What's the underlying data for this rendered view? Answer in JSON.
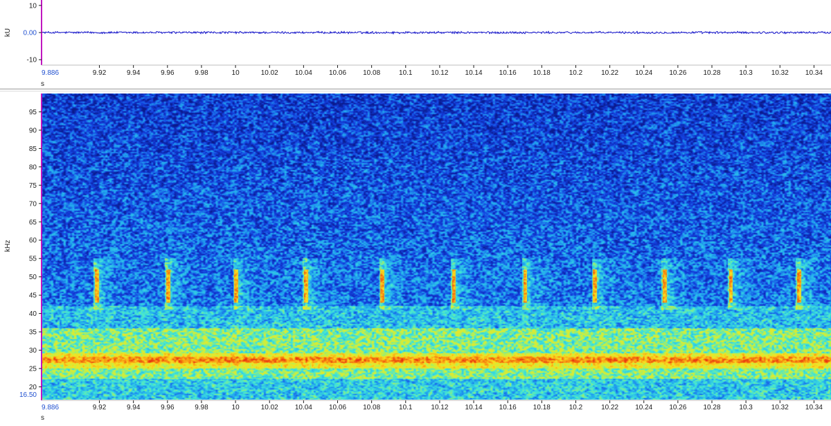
{
  "chart_data": [
    {
      "type": "line",
      "panel": "waveform",
      "ylabel": "kU",
      "xlabel": "s",
      "xlim": [
        9.886,
        10.35
      ],
      "ylim": [
        -12,
        12
      ],
      "y_ticks": [
        {
          "value": 10,
          "label": "10"
        },
        {
          "value": 0,
          "label": "0.00"
        },
        {
          "value": -10,
          "label": "-10"
        }
      ],
      "x_start_label": "9.886",
      "x_ticks": [
        {
          "value": 9.92,
          "label": "9.92"
        },
        {
          "value": 9.94,
          "label": "9.94"
        },
        {
          "value": 9.96,
          "label": "9.96"
        },
        {
          "value": 9.98,
          "label": "9.98"
        },
        {
          "value": 10.0,
          "label": "10"
        },
        {
          "value": 10.02,
          "label": "10.02"
        },
        {
          "value": 10.04,
          "label": "10.04"
        },
        {
          "value": 10.06,
          "label": "10.06"
        },
        {
          "value": 10.08,
          "label": "10.08"
        },
        {
          "value": 10.1,
          "label": "10.1"
        },
        {
          "value": 10.12,
          "label": "10.12"
        },
        {
          "value": 10.14,
          "label": "10.14"
        },
        {
          "value": 10.16,
          "label": "10.16"
        },
        {
          "value": 10.18,
          "label": "10.18"
        },
        {
          "value": 10.2,
          "label": "10.2"
        },
        {
          "value": 10.22,
          "label": "10.22"
        },
        {
          "value": 10.24,
          "label": "10.24"
        },
        {
          "value": 10.26,
          "label": "10.26"
        },
        {
          "value": 10.28,
          "label": "10.28"
        },
        {
          "value": 10.3,
          "label": "10.3"
        },
        {
          "value": 10.32,
          "label": "10.32"
        },
        {
          "value": 10.34,
          "label": "10.34"
        }
      ],
      "noise_amplitude": 0.35,
      "color": "#1010c8",
      "grid": false
    },
    {
      "type": "heatmap",
      "panel": "spectrogram",
      "ylabel": "kHz",
      "xlabel": "s",
      "xlim": [
        9.886,
        10.35
      ],
      "ylim": [
        16.5,
        100
      ],
      "y_start_label": "16.50",
      "y_ticks": [
        {
          "value": 20,
          "label": "20"
        },
        {
          "value": 25,
          "label": "25"
        },
        {
          "value": 30,
          "label": "30"
        },
        {
          "value": 35,
          "label": "35"
        },
        {
          "value": 40,
          "label": "40"
        },
        {
          "value": 45,
          "label": "45"
        },
        {
          "value": 50,
          "label": "50"
        },
        {
          "value": 55,
          "label": "55"
        },
        {
          "value": 60,
          "label": "60"
        },
        {
          "value": 65,
          "label": "65"
        },
        {
          "value": 70,
          "label": "70"
        },
        {
          "value": 75,
          "label": "75"
        },
        {
          "value": 80,
          "label": "80"
        },
        {
          "value": 85,
          "label": "85"
        },
        {
          "value": 90,
          "label": "90"
        },
        {
          "value": 95,
          "label": "95"
        }
      ],
      "x_start_label": "9.886",
      "x_ticks": [
        {
          "value": 9.92,
          "label": "9.92"
        },
        {
          "value": 9.94,
          "label": "9.94"
        },
        {
          "value": 9.96,
          "label": "9.96"
        },
        {
          "value": 9.98,
          "label": "9.98"
        },
        {
          "value": 10.0,
          "label": "10"
        },
        {
          "value": 10.02,
          "label": "10.02"
        },
        {
          "value": 10.04,
          "label": "10.04"
        },
        {
          "value": 10.06,
          "label": "10.06"
        },
        {
          "value": 10.08,
          "label": "10.08"
        },
        {
          "value": 10.1,
          "label": "10.1"
        },
        {
          "value": 10.12,
          "label": "10.12"
        },
        {
          "value": 10.14,
          "label": "10.14"
        },
        {
          "value": 10.16,
          "label": "10.16"
        },
        {
          "value": 10.18,
          "label": "10.18"
        },
        {
          "value": 10.2,
          "label": "10.2"
        },
        {
          "value": 10.22,
          "label": "10.22"
        },
        {
          "value": 10.24,
          "label": "10.24"
        },
        {
          "value": 10.26,
          "label": "10.26"
        },
        {
          "value": 10.28,
          "label": "10.28"
        },
        {
          "value": 10.3,
          "label": "10.3"
        },
        {
          "value": 10.32,
          "label": "10.32"
        },
        {
          "value": 10.34,
          "label": "10.34"
        }
      ],
      "call_times_s": [
        9.918,
        9.96,
        10.0,
        10.041,
        10.086,
        10.128,
        10.17,
        10.211,
        10.252,
        10.291,
        10.331
      ],
      "call_band_khz": [
        41,
        55
      ],
      "call_peak_khz": [
        43,
        52
      ],
      "noise_bands_khz": [
        {
          "from": 25,
          "to": 29,
          "level": 0.78,
          "label": "strong band"
        },
        {
          "from": 21,
          "to": 36,
          "level": 0.55,
          "label": "broadband low noise"
        },
        {
          "from": 36,
          "to": 42,
          "level": 0.35,
          "label": "mid noise"
        }
      ],
      "colormap": [
        "#0a1a8c",
        "#1440e0",
        "#22a8f0",
        "#40e6d8",
        "#c8f040",
        "#f8e020",
        "#f89010",
        "#e83010"
      ],
      "grid": false
    }
  ],
  "colors": {
    "axis_text": "#1a1a1a",
    "range_label": "#2050d0",
    "axis_line": "#c018c0",
    "divider": "#9a9a9a"
  }
}
